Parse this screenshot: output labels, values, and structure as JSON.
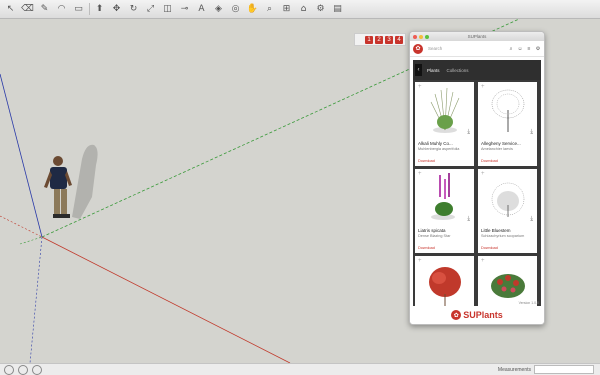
{
  "toolbar": {
    "icons": [
      "select-icon",
      "eraser-icon",
      "pencil-icon",
      "arc-icon",
      "rectangle-icon",
      "pushpull-icon",
      "move-icon",
      "rotate-icon",
      "scale-icon",
      "offset-icon",
      "tape-icon",
      "text-icon",
      "paint-icon",
      "orbit-icon",
      "pan-icon",
      "zoom-icon",
      "zoom-extents-icon",
      "warehouse-icon",
      "extension-icon",
      "layout-icon"
    ]
  },
  "extension_toolbar": {
    "buttons": [
      "1",
      "2",
      "3",
      "4"
    ]
  },
  "panel": {
    "title": "SUPlants",
    "search_placeholder": "Search",
    "tabs": [
      "Plants",
      "Collections"
    ],
    "plants": [
      {
        "name": "Alkali Muhly Co...",
        "sci": "Muhlenbergia asperifolia",
        "link": "Download"
      },
      {
        "name": "Allegheny Service...",
        "sci": "Amelanchier laevis",
        "link": "Download"
      },
      {
        "name": "Liatris spicata",
        "sci": "Dense Blazing Star",
        "link": "Download"
      },
      {
        "name": "Little Bluestem",
        "sci": "Schizachyrium scoparium",
        "link": "Download"
      },
      {
        "name": "",
        "sci": "",
        "link": ""
      },
      {
        "name": "",
        "sci": "",
        "link": ""
      }
    ],
    "brand": "SUPlants",
    "version": "Version 1.0.0"
  },
  "status": {
    "measurements_label": "Measurements"
  }
}
